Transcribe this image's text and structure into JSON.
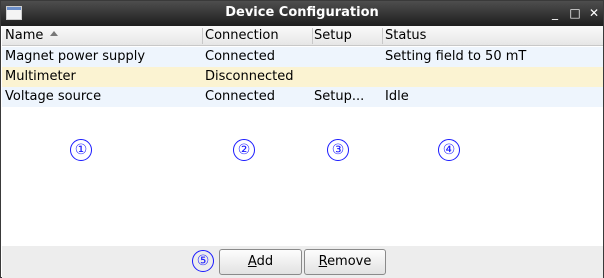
{
  "window": {
    "title": "Device Configuration",
    "controls": {
      "minimize": "_",
      "maximize": "□",
      "close": "✕"
    }
  },
  "table": {
    "columns": [
      "Name",
      "Connection",
      "Setup",
      "Status"
    ],
    "sort_column": "Name",
    "sort_direction": "ascending",
    "rows": [
      {
        "name": "Magnet power supply",
        "connection": "Connected",
        "setup": "",
        "status": "Setting field to 50 mT"
      },
      {
        "name": "Multimeter",
        "connection": "Disconnected",
        "setup": "",
        "status": ""
      },
      {
        "name": "Voltage source",
        "connection": "Connected",
        "setup": "Setup...",
        "status": "Idle"
      }
    ]
  },
  "markers": [
    "①",
    "②",
    "③",
    "④",
    "⑤"
  ],
  "buttons": {
    "add": {
      "mnemonic": "A",
      "rest": "dd"
    },
    "remove": {
      "mnemonic": "R",
      "rest": "emove"
    }
  },
  "colors": {
    "row_even": "#eef5fd",
    "row_highlight": "#fbf3d2",
    "marker": "#1a1aff",
    "titlebar": "#2e2e2e"
  }
}
